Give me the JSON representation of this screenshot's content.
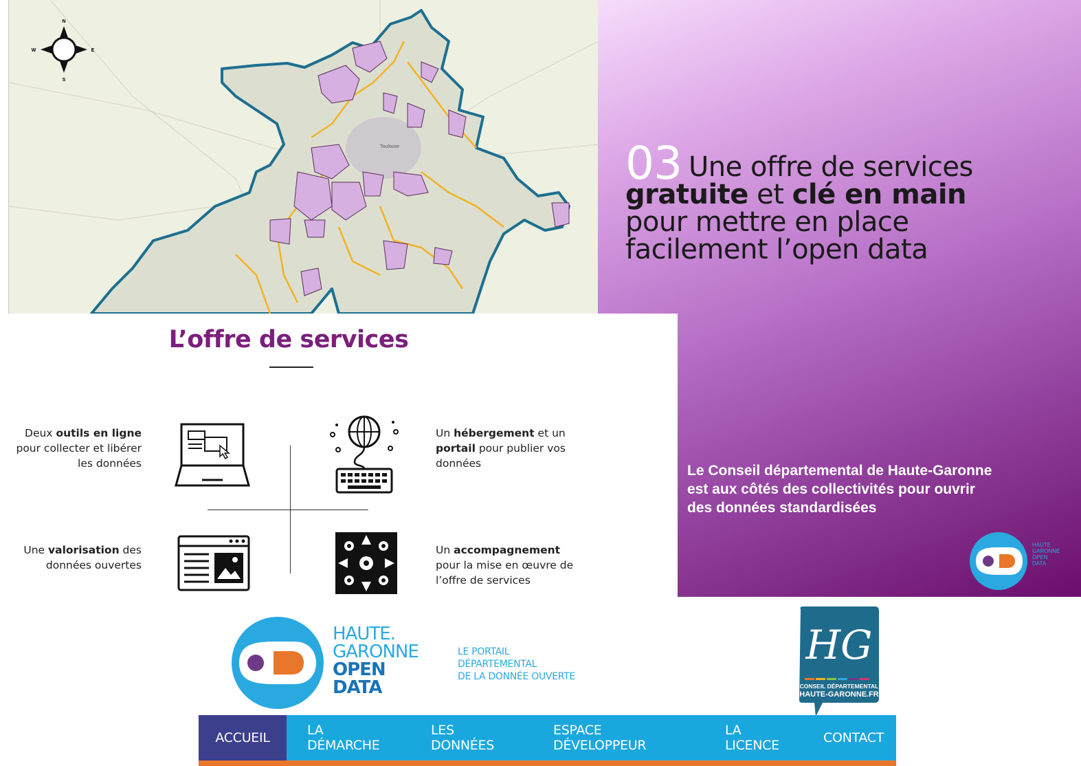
{
  "map": {
    "compass": {
      "n": "N",
      "s": "S",
      "e": "E",
      "w": "W"
    },
    "city_label": "Toulouse",
    "colors": {
      "boundary": "#1d6f90",
      "territories": "#f3b126",
      "participating": "#d6b0e0"
    }
  },
  "panel": {
    "number": "03",
    "title_line1": "Une offre de services",
    "title_bold1": "gratuite",
    "title_et": "et",
    "title_bold2": "clé en main",
    "title_line3": "pour mettre en place",
    "title_line4": "facilement l’open data",
    "description": "Le Conseil départemental de Haute-Garonne est aux côtés des collectivités pour ouvrir  des données standardisées",
    "logo_text": [
      "HAUTE",
      "GARONNE",
      "OPEN",
      "DATA"
    ]
  },
  "offer": {
    "title": "L’offre de services",
    "items": {
      "tools": {
        "pre": "Deux ",
        "bold": "outils en ligne",
        "post": " pour collecter et libérer les données",
        "icon": "laptop-icon"
      },
      "hosting": {
        "pre": "Un ",
        "bold": "hébergement",
        "mid": " et un ",
        "bold2": "portail",
        "post": " pour publier vos données",
        "icon": "globe-keyboard-icon"
      },
      "valorization": {
        "pre": "Une ",
        "bold": "valorisation",
        "post": " des données ouvertes",
        "icon": "webpage-icon"
      },
      "support": {
        "pre": "Un ",
        "bold": "accompagnement",
        "post": " pour la mise en œuvre de l’offre de services",
        "icon": "team-hands-icon"
      }
    }
  },
  "brand": {
    "name_lines": [
      "HAUTE.",
      "GARONNE",
      "OPEN",
      "DATA"
    ],
    "tagline_lines": [
      "LE PORTAIL",
      "DÉPARTEMENTAL",
      "DE LA DONNÉE OUVERTE"
    ],
    "hg": {
      "monogram": "HG",
      "line1": "CONSEIL DÉPARTEMENTAL",
      "line2": "HAUTE-GARONNE.FR"
    }
  },
  "nav": {
    "items": [
      "ACCUEIL",
      "LA DÉMARCHE",
      "LES DONNÉES",
      "ESPACE DÉVELOPPEUR",
      "LA LICENCE",
      "CONTACT"
    ],
    "active": "ACCUEIL",
    "colors": {
      "bar": "#1aa7de",
      "active": "#3b3f8c",
      "underline": "#e8772b"
    }
  }
}
